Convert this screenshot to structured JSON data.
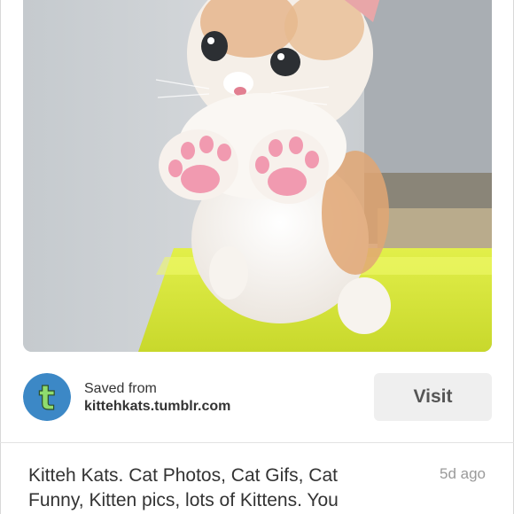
{
  "pin": {
    "image_subject": "kitten-photo",
    "colors": {
      "wall": "#c8ccd0",
      "ledge": "#d8e83a",
      "fur": "#f4efe9",
      "orange_fur": "#e0a673",
      "paw_pads": "#f19ab0"
    }
  },
  "source": {
    "avatar_icon": "tumblr-t-icon",
    "avatar_colors": {
      "background": "#3c88c6",
      "letter": "#8fdc6e"
    },
    "saved_label": "Saved from",
    "domain": "kittehkats.tumblr.com",
    "visit_label": "Visit"
  },
  "description": {
    "text": "Kitteh Kats. Cat Photos, Cat Gifs, Cat Funny, Kitten pics, lots of Kittens. You",
    "timestamp": "5d ago"
  }
}
